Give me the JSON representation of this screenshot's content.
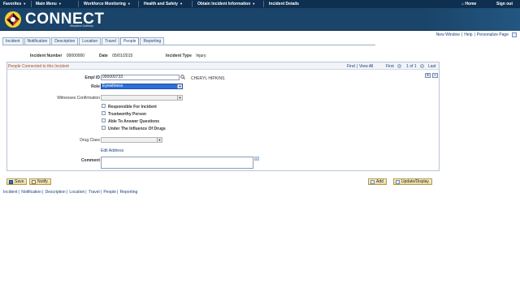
{
  "menubar": {
    "items": [
      "Favorites",
      "Main Menu",
      "Workforce Monitoring",
      "Health and Safety",
      "Obtain Incident Information",
      "Incident Details"
    ],
    "home": "Home",
    "signout": "Sign out"
  },
  "brand": {
    "name": "CONNECT",
    "sub": "Maryland Judiciary"
  },
  "header_links": [
    "New Window",
    "Help",
    "Personalize Page"
  ],
  "tabs": [
    "Incident",
    "Notification",
    "Description",
    "Location",
    "Travel",
    "People",
    "Reporting"
  ],
  "active_tab": "People",
  "record": {
    "incident_number_label": "Incident Number",
    "incident_number": "00000000",
    "date_label": "Date",
    "date": "05/01/2015",
    "incident_type_label": "Incident Type",
    "incident_type": "Injury"
  },
  "group": {
    "title": "People Connected to this Incident",
    "nav": {
      "find": "Find",
      "view_all": "View All",
      "first": "First",
      "range": "1 of 1",
      "last": "Last"
    },
    "add_row": "+",
    "delete_row": "−"
  },
  "form": {
    "empl_id_label": "Empl ID",
    "empl_id": "000000733",
    "employee_name": "CHERYL HIPKINS",
    "role_label": "Role",
    "role": "Eyewitness",
    "witness_conf_label": "Witnesses Confirmation",
    "witness_conf": "",
    "checkboxes": [
      "Responsible For Incident",
      "Trustworthy Person",
      "Able To Answer Questions",
      "Under The Influence Of Drugs"
    ],
    "drug_class_label": "Drug Class",
    "drug_class": "",
    "edit_address": "Edit Address",
    "comment_label": "Comment",
    "comment": ""
  },
  "buttons": {
    "save": "Save",
    "notify": "Notify",
    "add": "Add",
    "update_display": "Update/Display"
  },
  "footer_links": [
    "Incident",
    "Notification",
    "Description",
    "Location",
    "Travel",
    "People",
    "Reporting"
  ],
  "colors": {
    "menubar": "#0e2f4f",
    "banner": "#1a4469",
    "group_title": "#b04a1e",
    "link": "#1b3f7a",
    "role_highlight": "#2f6fd6"
  }
}
